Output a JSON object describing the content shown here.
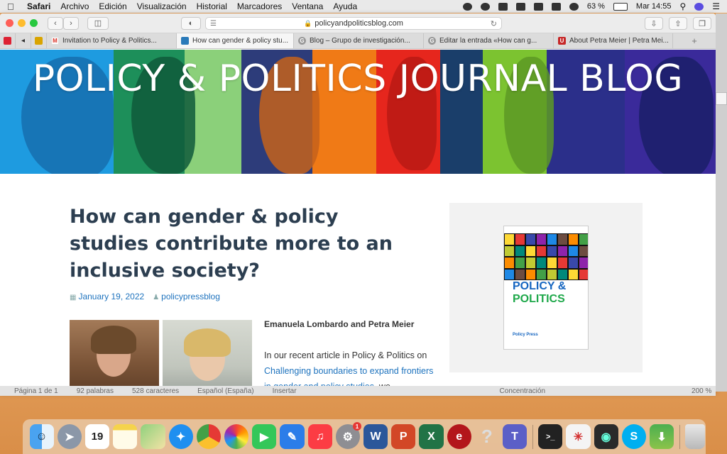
{
  "menubar": {
    "app": "Safari",
    "items": [
      "Archivo",
      "Edición",
      "Visualización",
      "Historial",
      "Marcadores",
      "Ventana",
      "Ayuda"
    ],
    "battery": "63 %",
    "clock": "Mar 14:55"
  },
  "browser": {
    "url": "policyandpoliticsblog.com",
    "tabs": [
      {
        "label": "Invitation to Policy & Politics...",
        "active": false
      },
      {
        "label": "How can gender & policy stu...",
        "active": true
      },
      {
        "label": "Blog – Grupo de investigación...",
        "active": false
      },
      {
        "label": "Editar la entrada «How can g...",
        "active": false
      },
      {
        "label": "About Petra Meier | Petra Mei...",
        "active": false
      }
    ]
  },
  "page": {
    "banner_title": "POLICY & POLITICS JOURNAL BLOG",
    "post_title": "How can gender & policy studies contribute more to an inclusive society?",
    "date": "January 19, 2022",
    "author": "policypressblog",
    "byline": "Emanuela Lombardo and Petra Meier",
    "intro_1": "In our recent article in Policy & Politics on ",
    "intro_link": "Challenging boundaries to expand frontiers in gender and policy studies",
    "intro_2": ", we",
    "cover_title_1": "POLICY &",
    "cover_title_2": "POLITICS",
    "cover_publisher": "Policy Press"
  },
  "wordbar": [
    "Página 1 de 1",
    "92 palabras",
    "528 caracteres",
    "Español (España)",
    "Insertar",
    "Concentración",
    "200 %"
  ],
  "dock": {
    "calendar_day": "19",
    "mail_badge": "1",
    "apps": [
      "Finder",
      "Launchpad",
      "Calendar",
      "Notes",
      "Maps",
      "Safari",
      "Chrome",
      "Photos",
      "FaceTime",
      "Keynote",
      "Music",
      "System Preferences",
      "Word",
      "PowerPoint",
      "Excel",
      "App",
      "Help",
      "Teams",
      "Terminal",
      "Acrobat",
      "App",
      "Skype",
      "App",
      "Trash"
    ]
  }
}
